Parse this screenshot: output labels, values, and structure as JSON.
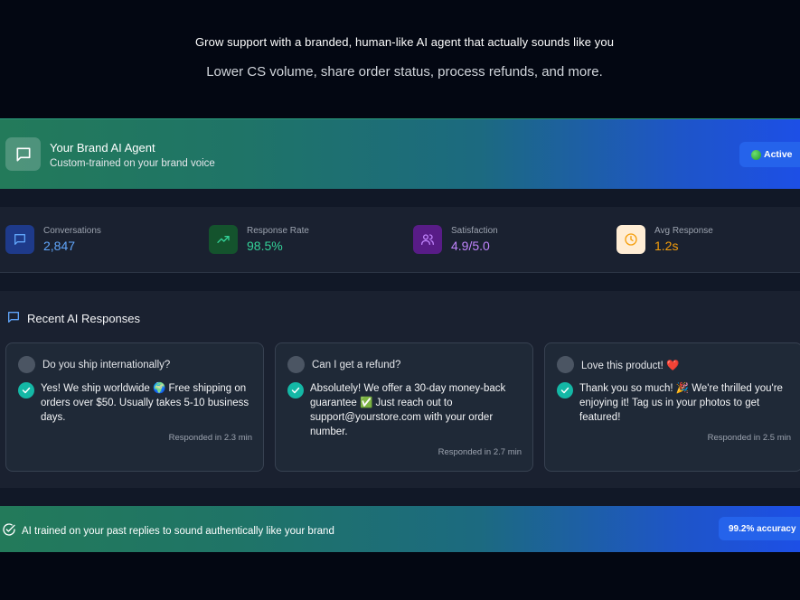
{
  "hero": {
    "headline": "Grow support with a branded, human-like AI agent that actually sounds like you",
    "subheadline": "Lower CS volume, share order status, process refunds, and more."
  },
  "agent": {
    "icon": "chat-bubble-icon",
    "title": "Your Brand AI Agent",
    "subtitle": "Custom-trained on your brand voice",
    "status": "Active"
  },
  "stats": [
    {
      "label": "Conversations",
      "value": "2,847",
      "icon": "chat-bubble-icon",
      "color": "#60a5fa",
      "bg": "#1e3a8a"
    },
    {
      "label": "Response Rate",
      "value": "98.5%",
      "icon": "trending-up-icon",
      "color": "#34d399",
      "bg": "#14532d"
    },
    {
      "label": "Satisfaction",
      "value": "4.9/5.0",
      "icon": "users-icon",
      "color": "#c084fc",
      "bg": "#581c87"
    },
    {
      "label": "Avg Response",
      "value": "1.2s",
      "icon": "clock-icon",
      "color": "#f59e0b",
      "bg": "#ffedd5"
    }
  ],
  "recent": {
    "heading": "Recent AI Responses",
    "cards": [
      {
        "question": "Do you ship internationally?",
        "answer": "Yes! We ship worldwide 🌍 Free shipping on orders over $50. Usually takes 5-10 business days.",
        "time": "Responded in 2.3 min"
      },
      {
        "question": "Can I get a refund?",
        "answer": "Absolutely! We offer a 30-day money-back guarantee ✅ Just reach out to support@yourstore.com with your order number.",
        "time": "Responded in 2.7 min"
      },
      {
        "question": "Love this product! ❤️",
        "answer": "Thank you so much! 🎉 We're thrilled you're enjoying it! Tag us in your photos to get featured!",
        "time": "Responded in 2.5 min"
      }
    ]
  },
  "footer": {
    "text": "AI trained on your past replies to sound authentically like your brand",
    "badge": "99.2% accuracy"
  }
}
